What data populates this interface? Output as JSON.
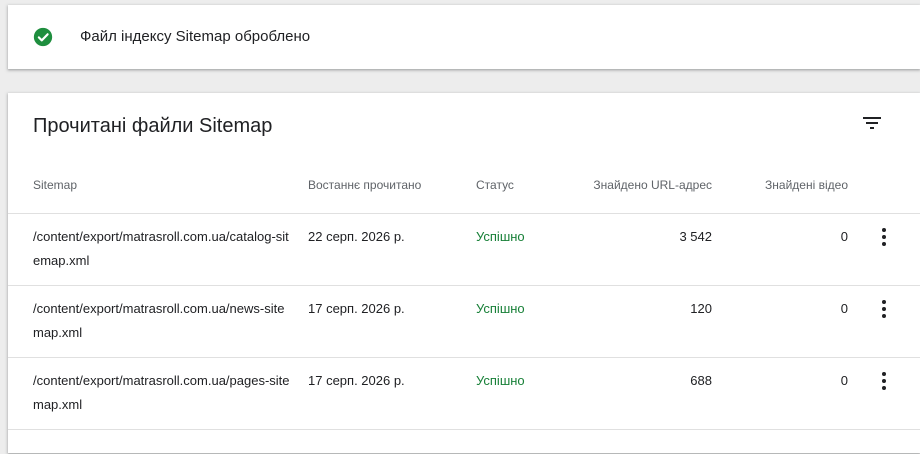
{
  "notice": {
    "icon": "check-circle-icon",
    "message": "Файл індексу Sitemap оброблено",
    "icon_color": "#1e8e3e"
  },
  "table": {
    "title": "Прочитані файли Sitemap",
    "filter_icon": "filter-icon",
    "columns": {
      "sitemap": "Sitemap",
      "last_read": "Востаннє прочитано",
      "status": "Статус",
      "urls_found": "Знайдено URL-адрес",
      "videos_found": "Знайдені відео"
    },
    "rows": [
      {
        "path": "/content/export/matrasroll.com.ua/catalog-sitemap.xml",
        "last_read": "22 серп. 2026 р.",
        "status": "Успішно",
        "urls_found": "3 542",
        "videos_found": "0"
      },
      {
        "path": "/content/export/matrasroll.com.ua/news-sitemap.xml",
        "last_read": "17 серп. 2026 р.",
        "status": "Успішно",
        "urls_found": "120",
        "videos_found": "0"
      },
      {
        "path": "/content/export/matrasroll.com.ua/pages-sitemap.xml",
        "last_read": "17 серп. 2026 р.",
        "status": "Успішно",
        "urls_found": "688",
        "videos_found": "0"
      }
    ],
    "status_color": "#188038",
    "row_menu_icon": "more-vert-icon"
  }
}
